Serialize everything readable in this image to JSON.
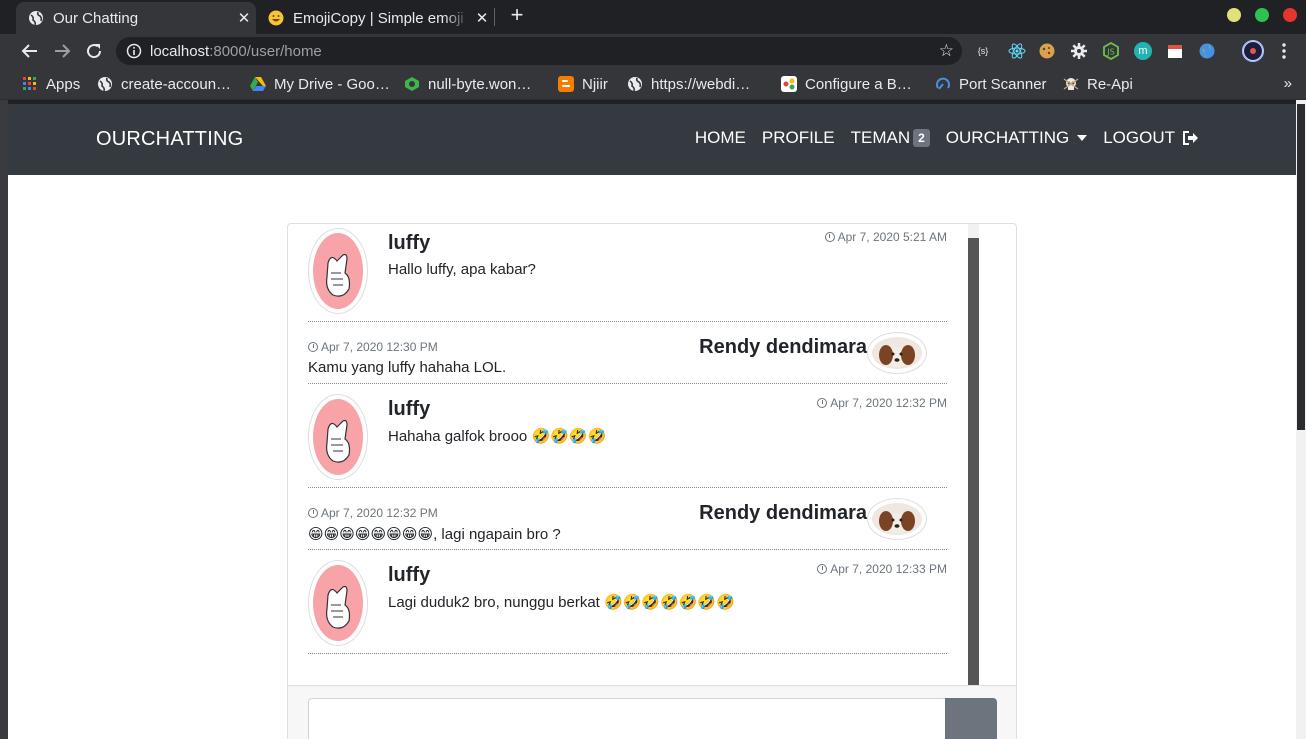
{
  "browser": {
    "tabs": [
      {
        "title": "Our Chatting",
        "icon": "globe-icon",
        "active": true
      },
      {
        "title": "EmojiCopy | Simple emoji",
        "icon": "grinning-emoji-icon",
        "active": false
      }
    ],
    "new_tab": "+",
    "close": "✕",
    "url_host": "localhost",
    "url_rest": ":8000/user/home",
    "window_buttons": {
      "minimize": "#e2e07a",
      "maximize": "#2ec350",
      "close": "#e6352d"
    }
  },
  "bookmarks": {
    "items": [
      {
        "label": "Apps",
        "icon": "apps-grid-icon"
      },
      {
        "label": "create-accoun…",
        "icon": "globe-icon"
      },
      {
        "label": "My Drive - Goo…",
        "icon": "google-drive-icon"
      },
      {
        "label": "null-byte.won…",
        "icon": "wonderhowto-icon"
      },
      {
        "label": "Njiir",
        "icon": "blogger-icon"
      },
      {
        "label": "https://webdi…",
        "icon": "globe-icon"
      },
      {
        "label": "Configure a B…",
        "icon": "dialogflow-icon"
      },
      {
        "label": "Port Scanner",
        "icon": "port-scanner-icon"
      },
      {
        "label": "Re-Api",
        "icon": "skull-icon"
      }
    ],
    "more": "»"
  },
  "site": {
    "brand": "OURCHATTING",
    "nav": {
      "home": "HOME",
      "profile": "PROFILE",
      "teman": "TEMAN",
      "teman_badge": "2",
      "ourchatting": "OURCHATTING",
      "logout": "LOGOUT"
    }
  },
  "chat": {
    "messages": [
      {
        "side": "left",
        "name": "luffy",
        "time": "Apr 7, 2020 5:21 AM",
        "text": "Hallo luffy, apa kabar?"
      },
      {
        "side": "right",
        "name": "Rendy dendimara",
        "time": "Apr 7, 2020 12:30 PM",
        "text": "Kamu yang luffy hahaha LOL."
      },
      {
        "side": "left",
        "name": "luffy",
        "time": "Apr 7, 2020 12:32 PM",
        "text": "Hahaha galfok brooo 🤣🤣🤣🤣"
      },
      {
        "side": "right",
        "name": "Rendy dendimara",
        "time": "Apr 7, 2020 12:32 PM",
        "text": "😁😁😁😁😁😁😁😁, lagi ngapain bro ?"
      },
      {
        "side": "left",
        "name": "luffy",
        "time": "Apr 7, 2020 12:33 PM",
        "text": "Lagi duduk2 bro, nunggu berkat 🤣🤣🤣🤣🤣🤣🤣"
      }
    ],
    "input_value": ""
  }
}
